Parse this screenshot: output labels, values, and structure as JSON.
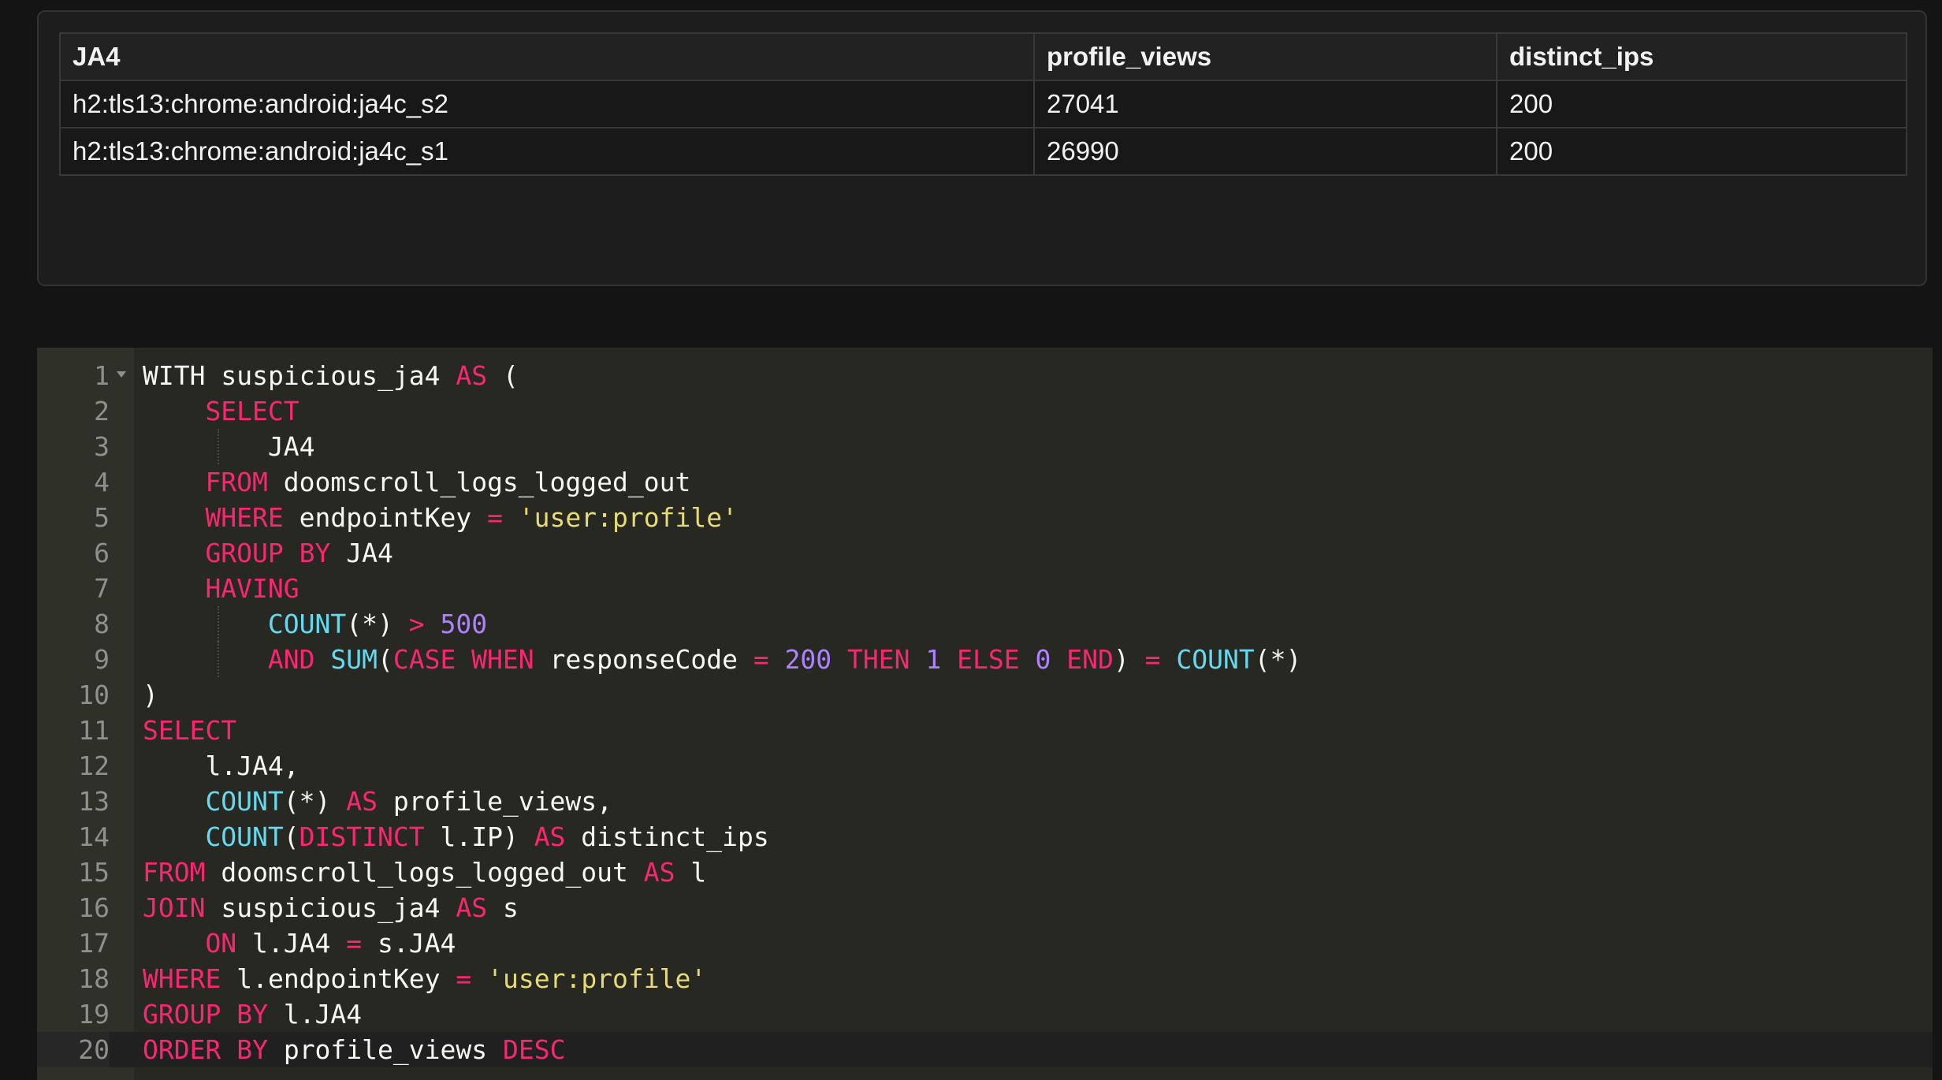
{
  "results": {
    "headers": [
      "JA4",
      "profile_views",
      "distinct_ips"
    ],
    "rows": [
      [
        "h2:tls13:chrome:android:ja4c_s2",
        "27041",
        "200"
      ],
      [
        "h2:tls13:chrome:android:ja4c_s1",
        "26990",
        "200"
      ]
    ]
  },
  "editor": {
    "active_line": 20,
    "lines": [
      {
        "n": "1",
        "fold": true,
        "indent": 0,
        "tokens": [
          [
            "kw2",
            "WITH"
          ],
          [
            "id",
            " suspicious_ja4 "
          ],
          [
            "kw",
            "AS"
          ],
          [
            "id",
            " ("
          ]
        ]
      },
      {
        "n": "2",
        "indent": 1,
        "tokens": [
          [
            "kw",
            "SELECT"
          ]
        ]
      },
      {
        "n": "3",
        "indent": 2,
        "tokens": [
          [
            "id",
            "JA4"
          ]
        ]
      },
      {
        "n": "4",
        "indent": 1,
        "tokens": [
          [
            "kw",
            "FROM"
          ],
          [
            "id",
            " doomscroll_logs_logged_out"
          ]
        ]
      },
      {
        "n": "5",
        "indent": 1,
        "tokens": [
          [
            "kw",
            "WHERE"
          ],
          [
            "id",
            " endpointKey "
          ],
          [
            "op",
            "="
          ],
          [
            "id",
            " "
          ],
          [
            "str",
            "'user:profile'"
          ]
        ]
      },
      {
        "n": "6",
        "indent": 1,
        "tokens": [
          [
            "kw",
            "GROUP BY"
          ],
          [
            "id",
            " JA4"
          ]
        ]
      },
      {
        "n": "7",
        "indent": 1,
        "tokens": [
          [
            "kw",
            "HAVING"
          ]
        ]
      },
      {
        "n": "8",
        "indent": 2,
        "tokens": [
          [
            "fn",
            "COUNT"
          ],
          [
            "id",
            "(*) "
          ],
          [
            "op",
            ">"
          ],
          [
            "id",
            " "
          ],
          [
            "num",
            "500"
          ]
        ]
      },
      {
        "n": "9",
        "indent": 2,
        "tokens": [
          [
            "kw",
            "AND"
          ],
          [
            "id",
            " "
          ],
          [
            "fn",
            "SUM"
          ],
          [
            "id",
            "("
          ],
          [
            "kw",
            "CASE WHEN"
          ],
          [
            "id",
            " responseCode "
          ],
          [
            "op",
            "="
          ],
          [
            "id",
            " "
          ],
          [
            "num",
            "200"
          ],
          [
            "id",
            " "
          ],
          [
            "kw",
            "THEN"
          ],
          [
            "id",
            " "
          ],
          [
            "num",
            "1"
          ],
          [
            "id",
            " "
          ],
          [
            "kw",
            "ELSE"
          ],
          [
            "id",
            " "
          ],
          [
            "num",
            "0"
          ],
          [
            "id",
            " "
          ],
          [
            "kw",
            "END"
          ],
          [
            "id",
            ") "
          ],
          [
            "op",
            "="
          ],
          [
            "id",
            " "
          ],
          [
            "fn",
            "COUNT"
          ],
          [
            "id",
            "(*)"
          ]
        ]
      },
      {
        "n": "10",
        "indent": 0,
        "tokens": [
          [
            "id",
            ")"
          ]
        ]
      },
      {
        "n": "11",
        "indent": 0,
        "tokens": [
          [
            "kw",
            "SELECT"
          ]
        ]
      },
      {
        "n": "12",
        "indent": 1,
        "tokens": [
          [
            "id",
            "l.JA4,"
          ]
        ]
      },
      {
        "n": "13",
        "indent": 1,
        "tokens": [
          [
            "fn",
            "COUNT"
          ],
          [
            "id",
            "(*) "
          ],
          [
            "kw",
            "AS"
          ],
          [
            "id",
            " profile_views,"
          ]
        ]
      },
      {
        "n": "14",
        "indent": 1,
        "tokens": [
          [
            "fn",
            "COUNT"
          ],
          [
            "id",
            "("
          ],
          [
            "kw",
            "DISTINCT"
          ],
          [
            "id",
            " l.IP) "
          ],
          [
            "kw",
            "AS"
          ],
          [
            "id",
            " distinct_ips"
          ]
        ]
      },
      {
        "n": "15",
        "indent": 0,
        "tokens": [
          [
            "kw",
            "FROM"
          ],
          [
            "id",
            " doomscroll_logs_logged_out "
          ],
          [
            "kw",
            "AS"
          ],
          [
            "id",
            " l"
          ]
        ]
      },
      {
        "n": "16",
        "indent": 0,
        "tokens": [
          [
            "kw",
            "JOIN"
          ],
          [
            "id",
            " suspicious_ja4 "
          ],
          [
            "kw",
            "AS"
          ],
          [
            "id",
            " s"
          ]
        ]
      },
      {
        "n": "17",
        "indent": 1,
        "tokens": [
          [
            "kw",
            "ON"
          ],
          [
            "id",
            " l.JA4 "
          ],
          [
            "op",
            "="
          ],
          [
            "id",
            " s.JA4"
          ]
        ]
      },
      {
        "n": "18",
        "indent": 0,
        "tokens": [
          [
            "kw",
            "WHERE"
          ],
          [
            "id",
            " l.endpointKey "
          ],
          [
            "op",
            "="
          ],
          [
            "id",
            " "
          ],
          [
            "str",
            "'user:profile'"
          ]
        ]
      },
      {
        "n": "19",
        "indent": 0,
        "tokens": [
          [
            "kw",
            "GROUP BY"
          ],
          [
            "id",
            " l.JA4"
          ]
        ]
      },
      {
        "n": "20",
        "indent": 0,
        "tokens": [
          [
            "kw",
            "ORDER BY"
          ],
          [
            "id",
            " profile_views "
          ],
          [
            "kw",
            "DESC"
          ]
        ]
      }
    ]
  }
}
